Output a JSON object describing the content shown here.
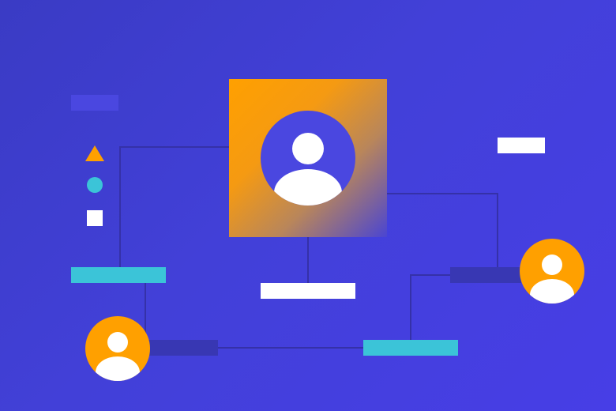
{
  "palette": {
    "background": "#4240d8",
    "accent_orange": "#ffa000",
    "accent_cyan": "#3bc4d8",
    "placeholder_blue": "#4a47e0",
    "placeholder_dark": "#3837b3",
    "white": "#ffffff",
    "connector": "#3531a8"
  },
  "legend": {
    "shapes": [
      "triangle-icon",
      "circle-icon",
      "square-icon"
    ]
  },
  "nodes": {
    "main_profile": {
      "icon": "user-icon",
      "style": "orange-gradient-card"
    },
    "left_profile": {
      "icon": "user-icon",
      "style": "orange-circle"
    },
    "right_profile": {
      "icon": "user-icon",
      "style": "orange-circle"
    }
  },
  "labels": {
    "top_left_bar": "",
    "top_right_bar": "",
    "center_bar": "",
    "left_cyan_bar": "",
    "bottom_cyan_bar": "",
    "left_dark_bar": "",
    "right_dark_bar": ""
  }
}
